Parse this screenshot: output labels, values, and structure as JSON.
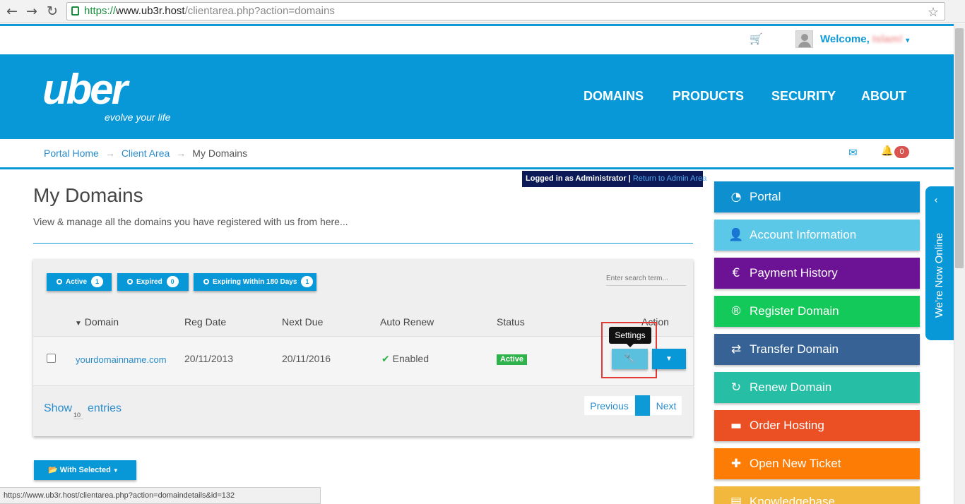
{
  "browser": {
    "url_scheme": "https://",
    "url_host": "www.ub3r.host",
    "url_path": "/clientarea.php?action=domains",
    "status_url": "https://www.ub3r.host/clientarea.php?action=domaindetails&id=132"
  },
  "topbar": {
    "welcome": "Welcome,",
    "username": "Islam!"
  },
  "header": {
    "logo": "uber",
    "tagline": "evolve your life",
    "nav": [
      "DOMAINS",
      "PRODUCTS",
      "SECURITY",
      "ABOUT"
    ]
  },
  "breadcrumb": {
    "items": [
      "Portal Home",
      "Client Area",
      "My Domains"
    ],
    "separator": "→",
    "notifications": "0"
  },
  "admin_bar": {
    "text": "Logged in as Administrator",
    "divider": "|",
    "link": "Return to Admin Area"
  },
  "page": {
    "title": "My Domains",
    "description": "View & manage all the domains you have registered with us from here..."
  },
  "filters": [
    {
      "label": "Active",
      "count": "1"
    },
    {
      "label": "Expired",
      "count": "0"
    },
    {
      "label": "Expiring Within 180 Days",
      "count": "1"
    }
  ],
  "search": {
    "placeholder": "Enter search term..."
  },
  "table": {
    "columns": [
      "Domain",
      "Reg Date",
      "Next Due",
      "Auto Renew",
      "Status",
      "Action"
    ],
    "rows": [
      {
        "domain": "yourdomainname.com",
        "reg_date": "20/11/2013",
        "next_due": "20/11/2016",
        "auto_renew": "Enabled",
        "status": "Active"
      }
    ],
    "tooltip": "Settings"
  },
  "footer": {
    "show": "Show",
    "entries_count": "10",
    "entries": "entries",
    "previous": "Previous",
    "page": "1",
    "next": "Next",
    "with_selected": "With Selected"
  },
  "sidebar": {
    "items": [
      {
        "label": "Portal",
        "icon": "dashboard-icon",
        "color": "#0d8fd0"
      },
      {
        "label": "Account Information",
        "icon": "user-icon",
        "color": "#5bc8e8"
      },
      {
        "label": "Payment History",
        "icon": "euro-icon",
        "color": "#6c1294"
      },
      {
        "label": "Register Domain",
        "icon": "register-icon",
        "color": "#13c95a"
      },
      {
        "label": "Transfer Domain",
        "icon": "transfer-icon",
        "color": "#366295"
      },
      {
        "label": "Renew Domain",
        "icon": "refresh-icon",
        "color": "#26bfa5"
      },
      {
        "label": "Order Hosting",
        "icon": "server-icon",
        "color": "#ea5024"
      },
      {
        "label": "Open New Ticket",
        "icon": "plus-icon",
        "color": "#fd7c05"
      },
      {
        "label": "Knowledgebase",
        "icon": "book-icon",
        "color": "#f2b83e"
      }
    ]
  },
  "online_tab": {
    "label": "We're Now Online"
  }
}
